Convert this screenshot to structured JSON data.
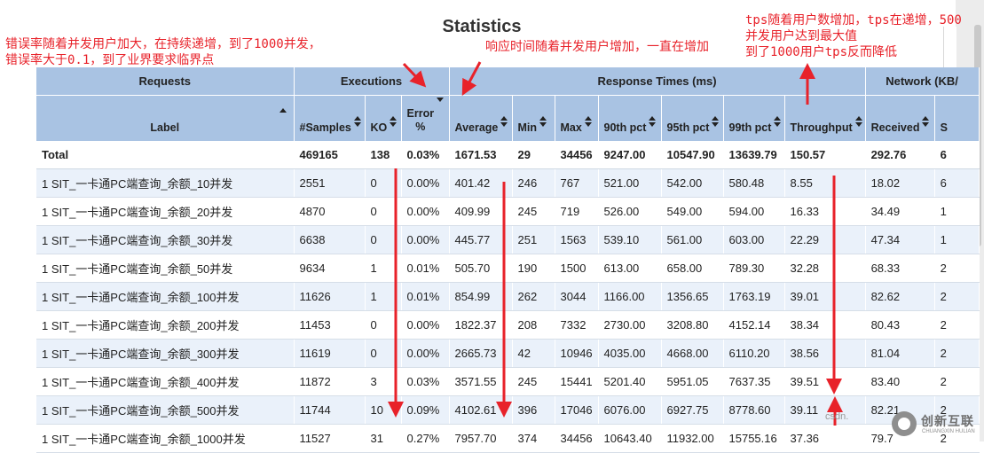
{
  "title": "Statistics",
  "groups": {
    "requests": "Requests",
    "executions": "Executions",
    "response_times": "Response Times (ms)",
    "network": "Network (KB/"
  },
  "columns": {
    "label": "Label",
    "samples": "#Samples",
    "ko": "KO",
    "error_pct_line1": "Error",
    "error_pct_line2": "%",
    "average": "Average",
    "min": "Min",
    "max": "Max",
    "p90": "90th pct",
    "p95": "95th pct",
    "p99": "99th pct",
    "throughput": "Throughput",
    "received": "Received",
    "sent": "S"
  },
  "total": {
    "label": "Total",
    "samples": "469165",
    "ko": "138",
    "error": "0.03%",
    "average": "1671.53",
    "min": "29",
    "max": "34456",
    "p90": "9247.00",
    "p95": "10547.90",
    "p99": "13639.79",
    "throughput": "150.57",
    "received": "292.76",
    "sent": "6"
  },
  "rows": [
    {
      "label": "1 SIT_一卡通PC端查询_余额_10并发",
      "samples": "2551",
      "ko": "0",
      "error": "0.00%",
      "average": "401.42",
      "min": "246",
      "max": "767",
      "p90": "521.00",
      "p95": "542.00",
      "p99": "580.48",
      "throughput": "8.55",
      "received": "18.02",
      "sent": "6"
    },
    {
      "label": "1 SIT_一卡通PC端查询_余额_20并发",
      "samples": "4870",
      "ko": "0",
      "error": "0.00%",
      "average": "409.99",
      "min": "245",
      "max": "719",
      "p90": "526.00",
      "p95": "549.00",
      "p99": "594.00",
      "throughput": "16.33",
      "received": "34.49",
      "sent": "1"
    },
    {
      "label": "1 SIT_一卡通PC端查询_余额_30并发",
      "samples": "6638",
      "ko": "0",
      "error": "0.00%",
      "average": "445.77",
      "min": "251",
      "max": "1563",
      "p90": "539.10",
      "p95": "561.00",
      "p99": "603.00",
      "throughput": "22.29",
      "received": "47.34",
      "sent": "1"
    },
    {
      "label": "1 SIT_一卡通PC端查询_余额_50并发",
      "samples": "9634",
      "ko": "1",
      "error": "0.01%",
      "average": "505.70",
      "min": "190",
      "max": "1500",
      "p90": "613.00",
      "p95": "658.00",
      "p99": "789.30",
      "throughput": "32.28",
      "received": "68.33",
      "sent": "2"
    },
    {
      "label": "1 SIT_一卡通PC端查询_余额_100并发",
      "samples": "11626",
      "ko": "1",
      "error": "0.01%",
      "average": "854.99",
      "min": "262",
      "max": "3044",
      "p90": "1166.00",
      "p95": "1356.65",
      "p99": "1763.19",
      "throughput": "39.01",
      "received": "82.62",
      "sent": "2"
    },
    {
      "label": "1 SIT_一卡通PC端查询_余额_200并发",
      "samples": "11453",
      "ko": "0",
      "error": "0.00%",
      "average": "1822.37",
      "min": "208",
      "max": "7332",
      "p90": "2730.00",
      "p95": "3208.80",
      "p99": "4152.14",
      "throughput": "38.34",
      "received": "80.43",
      "sent": "2"
    },
    {
      "label": "1 SIT_一卡通PC端查询_余额_300并发",
      "samples": "11619",
      "ko": "0",
      "error": "0.00%",
      "average": "2665.73",
      "min": "42",
      "max": "10946",
      "p90": "4035.00",
      "p95": "4668.00",
      "p99": "6110.20",
      "throughput": "38.56",
      "received": "81.04",
      "sent": "2"
    },
    {
      "label": "1 SIT_一卡通PC端查询_余额_400并发",
      "samples": "11872",
      "ko": "3",
      "error": "0.03%",
      "average": "3571.55",
      "min": "245",
      "max": "15441",
      "p90": "5201.40",
      "p95": "5951.05",
      "p99": "7637.35",
      "throughput": "39.51",
      "received": "83.40",
      "sent": "2"
    },
    {
      "label": "1 SIT_一卡通PC端查询_余额_500并发",
      "samples": "11744",
      "ko": "10",
      "error": "0.09%",
      "average": "4102.61",
      "min": "396",
      "max": "17046",
      "p90": "6076.00",
      "p95": "6927.75",
      "p99": "8778.60",
      "throughput": "39.11",
      "received": "82.21",
      "sent": "2"
    },
    {
      "label": "1 SIT_一卡通PC端查询_余额_1000并发",
      "samples": "11527",
      "ko": "31",
      "error": "0.27%",
      "average": "7957.70",
      "min": "374",
      "max": "34456",
      "p90": "10643.40",
      "p95": "11932.00",
      "p99": "15755.16",
      "throughput": "37.36",
      "received": "79.7",
      "sent": "2"
    }
  ],
  "annotations": {
    "error_line1": "错误率随着并发用户加大，在持续递增，到了1000并发，",
    "error_line2": "错误率大于0.1，到了业界要求临界点",
    "response": "响应时间随着并发用户增加，一直在增加",
    "tps_line1": "tps随着用户数增加，tps在递增，500",
    "tps_line2": "并发用户达到最大值",
    "tps_line3": "到了1000用户tps反而降低"
  },
  "watermark": "csdn.",
  "logo": {
    "name": "创新互联",
    "sub": "CHUANGXIN HULIAN"
  },
  "colors": {
    "header": "#a9c3e3",
    "row_alt": "#eaf1fa",
    "annotation": "#e8222a"
  }
}
